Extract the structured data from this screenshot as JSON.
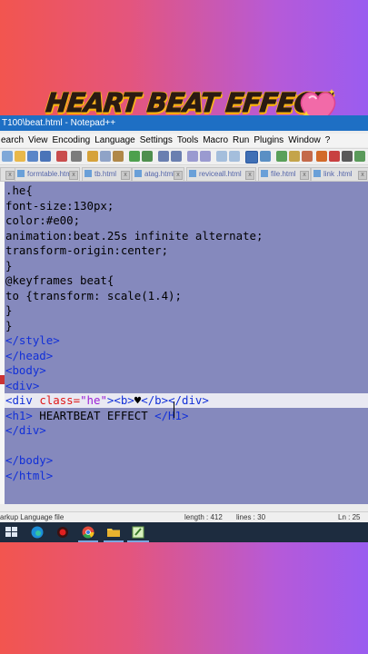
{
  "overlay": {
    "headline": "HEART BEAT EFFECT"
  },
  "window": {
    "title": "T100\\beat.html - Notepad++"
  },
  "menu": [
    "earch",
    "View",
    "Encoding",
    "Language",
    "Settings",
    "Tools",
    "Macro",
    "Run",
    "Plugins",
    "Window",
    "?"
  ],
  "tabs": [
    "formtable.html",
    "tb.html",
    "atag.html",
    "reviceall.html",
    "file.html",
    "link .html"
  ],
  "code_lines": [
    [
      {
        "t": ".he{",
        "c": "txt"
      }
    ],
    [
      {
        "t": "font-size:130px;",
        "c": "txt"
      }
    ],
    [
      {
        "t": "color:#e00;",
        "c": "txt"
      }
    ],
    [
      {
        "t": "animation:beat.25s infinite alternate;",
        "c": "txt"
      }
    ],
    [
      {
        "t": "transform-origin:center;",
        "c": "txt"
      }
    ],
    [
      {
        "t": "}",
        "c": "txt"
      }
    ],
    [
      {
        "t": "@keyframes beat{",
        "c": "txt"
      }
    ],
    [
      {
        "t": "to {transform: scale(1.4);",
        "c": "txt"
      }
    ],
    [
      {
        "t": "}",
        "c": "txt"
      }
    ],
    [
      {
        "t": "}",
        "c": "txt"
      }
    ],
    [
      {
        "t": "</style>",
        "c": "tag"
      }
    ],
    [
      {
        "t": "</head>",
        "c": "tag"
      }
    ],
    [
      {
        "t": "<body>",
        "c": "tag"
      }
    ],
    [
      {
        "t": "<div>",
        "c": "tag"
      }
    ],
    [
      {
        "t": "<div ",
        "c": "tag"
      },
      {
        "t": "class=",
        "c": "attr"
      },
      {
        "t": "\"he\"",
        "c": "str"
      },
      {
        "t": "><b>",
        "c": "tag"
      },
      {
        "t": "♥",
        "c": "txt"
      },
      {
        "t": "</b></div>",
        "c": "tag"
      }
    ],
    [
      {
        "t": "<h1>",
        "c": "tag"
      },
      {
        "t": " HEARTBEAT EFFECT ",
        "c": "txt"
      },
      {
        "t": "</H1>",
        "c": "tag"
      }
    ],
    [
      {
        "t": "</div>",
        "c": "tag"
      }
    ],
    [
      {
        "t": "",
        "c": "txt"
      }
    ],
    [
      {
        "t": "</body>",
        "c": "tag"
      }
    ],
    [
      {
        "t": "</html>",
        "c": "tag"
      }
    ]
  ],
  "status": {
    "left": "arkup Language file",
    "length": "length : 412",
    "lines": "lines : 30",
    "position": "Ln : 25"
  },
  "colors": {
    "background_left": "#f2554f",
    "background_right": "#9a5cf0",
    "editor_bg": "#8589bd",
    "tag": "#1230d8",
    "attr": "#e01818",
    "string": "#9b1fd6",
    "titlebar": "#1e6fc4"
  },
  "icons": [
    "sparkling-heart-icon",
    "windows-start-icon",
    "edge-icon",
    "record-icon",
    "chrome-icon",
    "file-explorer-icon",
    "notepadpp-icon"
  ]
}
